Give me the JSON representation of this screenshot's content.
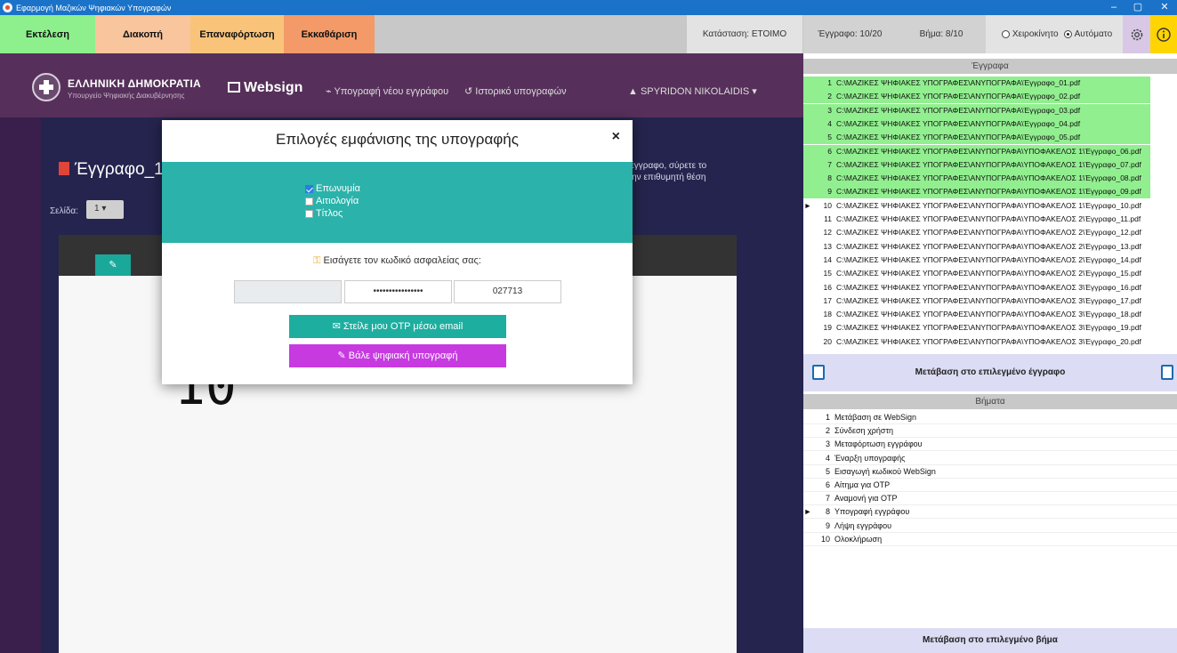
{
  "window": {
    "title": "Εφαρμογή Μαζικών Ψηφιακών Υπογραφών",
    "controls": {
      "minimize": "–",
      "maximize": "▢",
      "close": "✕"
    }
  },
  "toolbar": {
    "run": "Εκτέλεση",
    "stop": "Διακοπή",
    "reload": "Επαναφόρτωση",
    "clear": "Εκκαθάριση",
    "status": "Κατάσταση: ΕΤΟΙΜΟ",
    "doc_counter": "Έγγραφο: 10/20",
    "step_counter": "Βήμα: 8/10",
    "mode_manual": "Χειροκίνητο",
    "mode_auto": "Αυτόματο",
    "selected_mode": "auto",
    "colors": {
      "run": "#8ef08c",
      "stop": "#f9c59d",
      "reload": "#f9c47a",
      "clear": "#f39a68",
      "gear_bg": "#d8c8e6",
      "info_bg": "#ffd400"
    }
  },
  "web": {
    "gov_title": "ΕΛΛΗΝΙΚΗ ΔΗΜΟΚΡΑΤΙΑ",
    "gov_subtitle": "Υπουργείο Ψηφιακής Διακυβέρνησης",
    "brand": "Websign",
    "nav_new": "⌁ Υπογραφή νέου εγγράφου",
    "nav_history": "↺ Ιστορικό υπογραφών",
    "user": "▲ SPYRIDON NIKOLAIDIS ▾",
    "doc_title": "Έγγραφο_1",
    "page_label": "Σελίδα:",
    "page_value": "1",
    "drag_hint_1": "ο έγγραφο, σύρετε το",
    "drag_hint_2": "στην επιθυμητή θέση",
    "edit_icon": "✎",
    "page_big_number": "10"
  },
  "modal": {
    "title": "Επιλογές εμφάνισης της υπογραφής",
    "close": "×",
    "checkboxes": [
      {
        "label": "Επωνυμία",
        "checked": true
      },
      {
        "label": "Αιτιολογία",
        "checked": false
      },
      {
        "label": "Τίτλος",
        "checked": false
      }
    ],
    "password_prompt": "Εισάγετε τον κωδικό ασφαλείας σας:",
    "password_masked": "••••••••••••••••",
    "otp_value": "027713",
    "send_otp_button": "✉ Στείλε μου OTP μέσω email",
    "sign_button": "✎ Βάλε ψηφιακή υπογραφή",
    "colors": {
      "teal": "#2bb2aa",
      "otp_btn": "#1eaea0",
      "sign_btn": "#c63ae0"
    }
  },
  "documents": {
    "header": "Έγγραφα",
    "current_index": 10,
    "rows": [
      {
        "n": "1",
        "path": "C:\\ΜΑΖΙΚΕΣ ΨΗΦΙΑΚΕΣ ΥΠΟΓΡΑΦΕΣ\\ΑΝΥΠΟΓΡΑΦΑ\\Έγγραφο_01.pdf"
      },
      {
        "n": "2",
        "path": "C:\\ΜΑΖΙΚΕΣ ΨΗΦΙΑΚΕΣ ΥΠΟΓΡΑΦΕΣ\\ΑΝΥΠΟΓΡΑΦΑ\\Έγγραφο_02.pdf"
      },
      {
        "n": "3",
        "path": "C:\\ΜΑΖΙΚΕΣ ΨΗΦΙΑΚΕΣ ΥΠΟΓΡΑΦΕΣ\\ΑΝΥΠΟΓΡΑΦΑ\\Έγγραφο_03.pdf"
      },
      {
        "n": "4",
        "path": "C:\\ΜΑΖΙΚΕΣ ΨΗΦΙΑΚΕΣ ΥΠΟΓΡΑΦΕΣ\\ΑΝΥΠΟΓΡΑΦΑ\\Έγγραφο_04.pdf"
      },
      {
        "n": "5",
        "path": "C:\\ΜΑΖΙΚΕΣ ΨΗΦΙΑΚΕΣ ΥΠΟΓΡΑΦΕΣ\\ΑΝΥΠΟΓΡΑΦΑ\\Έγγραφο_05.pdf"
      },
      {
        "n": "6",
        "path": "C:\\ΜΑΖΙΚΕΣ ΨΗΦΙΑΚΕΣ ΥΠΟΓΡΑΦΕΣ\\ΑΝΥΠΟΓΡΑΦΑ\\ΥΠΟΦΑΚΕΛΟΣ 1\\Έγγραφο_06.pdf"
      },
      {
        "n": "7",
        "path": "C:\\ΜΑΖΙΚΕΣ ΨΗΦΙΑΚΕΣ ΥΠΟΓΡΑΦΕΣ\\ΑΝΥΠΟΓΡΑΦΑ\\ΥΠΟΦΑΚΕΛΟΣ 1\\Έγγραφο_07.pdf"
      },
      {
        "n": "8",
        "path": "C:\\ΜΑΖΙΚΕΣ ΨΗΦΙΑΚΕΣ ΥΠΟΓΡΑΦΕΣ\\ΑΝΥΠΟΓΡΑΦΑ\\ΥΠΟΦΑΚΕΛΟΣ 1\\Έγγραφο_08.pdf"
      },
      {
        "n": "9",
        "path": "C:\\ΜΑΖΙΚΕΣ ΨΗΦΙΑΚΕΣ ΥΠΟΓΡΑΦΕΣ\\ΑΝΥΠΟΓΡΑΦΑ\\ΥΠΟΦΑΚΕΛΟΣ 1\\Έγγραφο_09.pdf"
      },
      {
        "n": "10",
        "path": "C:\\ΜΑΖΙΚΕΣ ΨΗΦΙΑΚΕΣ ΥΠΟΓΡΑΦΕΣ\\ΑΝΥΠΟΓΡΑΦΑ\\ΥΠΟΦΑΚΕΛΟΣ 1\\Έγγραφο_10.pdf"
      },
      {
        "n": "11",
        "path": "C:\\ΜΑΖΙΚΕΣ ΨΗΦΙΑΚΕΣ ΥΠΟΓΡΑΦΕΣ\\ΑΝΥΠΟΓΡΑΦΑ\\ΥΠΟΦΑΚΕΛΟΣ 2\\Έγγραφο_11.pdf"
      },
      {
        "n": "12",
        "path": "C:\\ΜΑΖΙΚΕΣ ΨΗΦΙΑΚΕΣ ΥΠΟΓΡΑΦΕΣ\\ΑΝΥΠΟΓΡΑΦΑ\\ΥΠΟΦΑΚΕΛΟΣ 2\\Έγγραφο_12.pdf"
      },
      {
        "n": "13",
        "path": "C:\\ΜΑΖΙΚΕΣ ΨΗΦΙΑΚΕΣ ΥΠΟΓΡΑΦΕΣ\\ΑΝΥΠΟΓΡΑΦΑ\\ΥΠΟΦΑΚΕΛΟΣ 2\\Έγγραφο_13.pdf"
      },
      {
        "n": "14",
        "path": "C:\\ΜΑΖΙΚΕΣ ΨΗΦΙΑΚΕΣ ΥΠΟΓΡΑΦΕΣ\\ΑΝΥΠΟΓΡΑΦΑ\\ΥΠΟΦΑΚΕΛΟΣ 2\\Έγγραφο_14.pdf"
      },
      {
        "n": "15",
        "path": "C:\\ΜΑΖΙΚΕΣ ΨΗΦΙΑΚΕΣ ΥΠΟΓΡΑΦΕΣ\\ΑΝΥΠΟΓΡΑΦΑ\\ΥΠΟΦΑΚΕΛΟΣ 2\\Έγγραφο_15.pdf"
      },
      {
        "n": "16",
        "path": "C:\\ΜΑΖΙΚΕΣ ΨΗΦΙΑΚΕΣ ΥΠΟΓΡΑΦΕΣ\\ΑΝΥΠΟΓΡΑΦΑ\\ΥΠΟΦΑΚΕΛΟΣ 3\\Έγγραφο_16.pdf"
      },
      {
        "n": "17",
        "path": "C:\\ΜΑΖΙΚΕΣ ΨΗΦΙΑΚΕΣ ΥΠΟΓΡΑΦΕΣ\\ΑΝΥΠΟΓΡΑΦΑ\\ΥΠΟΦΑΚΕΛΟΣ 3\\Έγγραφο_17.pdf"
      },
      {
        "n": "18",
        "path": "C:\\ΜΑΖΙΚΕΣ ΨΗΦΙΑΚΕΣ ΥΠΟΓΡΑΦΕΣ\\ΑΝΥΠΟΓΡΑΦΑ\\ΥΠΟΦΑΚΕΛΟΣ 3\\Έγγραφο_18.pdf"
      },
      {
        "n": "19",
        "path": "C:\\ΜΑΖΙΚΕΣ ΨΗΦΙΑΚΕΣ ΥΠΟΓΡΑΦΕΣ\\ΑΝΥΠΟΓΡΑΦΑ\\ΥΠΟΦΑΚΕΛΟΣ 3\\Έγγραφο_19.pdf"
      },
      {
        "n": "20",
        "path": "C:\\ΜΑΖΙΚΕΣ ΨΗΦΙΑΚΕΣ ΥΠΟΓΡΑΦΕΣ\\ΑΝΥΠΟΓΡΑΦΑ\\ΥΠΟΦΑΚΕΛΟΣ 3\\Έγγραφο_20.pdf"
      }
    ],
    "completed_count": 9,
    "goto_button": "Μετάβαση στο επιλεγμένο έγγραφο"
  },
  "steps": {
    "header": "Βήματα",
    "current_index": 8,
    "rows": [
      {
        "n": "1",
        "label": "Μετάβαση σε WebSign"
      },
      {
        "n": "2",
        "label": "Σύνδεση χρήστη"
      },
      {
        "n": "3",
        "label": "Μεταφόρτωση εγγράφου"
      },
      {
        "n": "4",
        "label": "Έναρξη υπογραφής"
      },
      {
        "n": "5",
        "label": "Εισαγωγή κωδικού WebSign"
      },
      {
        "n": "6",
        "label": "Αίτημα για OTP"
      },
      {
        "n": "7",
        "label": "Αναμονή για OTP"
      },
      {
        "n": "8",
        "label": "Υπογραφή εγγράφου"
      },
      {
        "n": "9",
        "label": "Λήψη εγγράφου"
      },
      {
        "n": "10",
        "label": "Ολοκλήρωση"
      }
    ],
    "goto_button": "Μετάβαση στο επιλεγμένο βήμα"
  }
}
